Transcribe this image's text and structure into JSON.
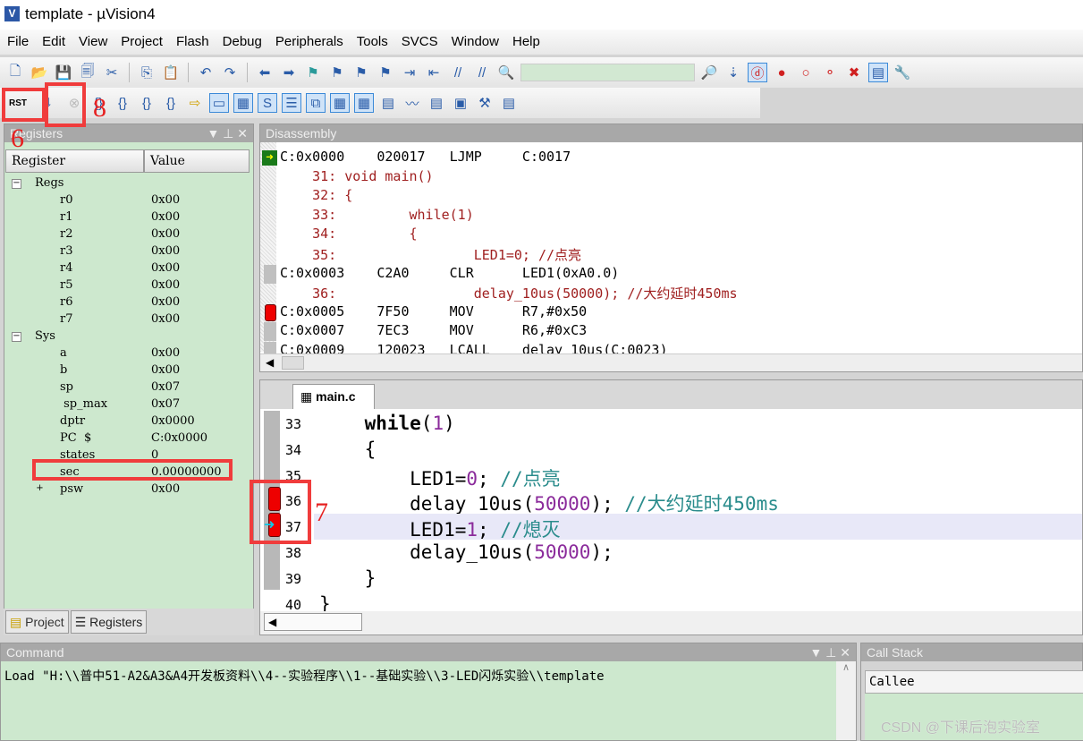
{
  "window": {
    "title": "template  - µVision4",
    "icon": "V"
  },
  "menu": [
    "File",
    "Edit",
    "View",
    "Project",
    "Flash",
    "Debug",
    "Peripherals",
    "Tools",
    "SVCS",
    "Window",
    "Help"
  ],
  "toolbar": {
    "rst_label": "RST",
    "icons1": [
      "new-file",
      "open-folder",
      "save",
      "save-all",
      "cut",
      "copy",
      "paste",
      "undo",
      "redo",
      "nav-back",
      "nav-forward",
      "bookmark",
      "prev-bookmark",
      "next-bookmark",
      "clear-bookmarks",
      "indent",
      "unindent",
      "comment",
      "uncomment",
      "find-in-files"
    ],
    "icons1b": [
      "find",
      "incremental-find",
      "start-debug",
      "insert-breakpoint",
      "enable-breakpoint",
      "disable-breakpoints",
      "kill-breakpoints",
      "window-layout",
      "configure"
    ],
    "icons2": [
      "step-into",
      "step-over",
      "step-out",
      "run-to-cursor",
      "show-next-statement",
      "command-window",
      "disassembly-window",
      "symbols-window",
      "registers-window",
      "call-stack-window",
      "watch-window",
      "memory-window",
      "serial-window",
      "analysis-window",
      "trace-window",
      "system-viewer",
      "toolbox",
      "debug-restore-views"
    ]
  },
  "registers": {
    "title": "Registers",
    "col_register": "Register",
    "col_value": "Value",
    "groups": [
      {
        "name": "Regs",
        "items": [
          [
            "r0",
            "0x00"
          ],
          [
            "r1",
            "0x00"
          ],
          [
            "r2",
            "0x00"
          ],
          [
            "r3",
            "0x00"
          ],
          [
            "r4",
            "0x00"
          ],
          [
            "r5",
            "0x00"
          ],
          [
            "r6",
            "0x00"
          ],
          [
            "r7",
            "0x00"
          ]
        ]
      },
      {
        "name": "Sys",
        "items": [
          [
            "a",
            "0x00"
          ],
          [
            "b",
            "0x00"
          ],
          [
            "sp",
            "0x07"
          ],
          [
            " sp_max",
            "0x07"
          ],
          [
            "dptr",
            "0x0000"
          ],
          [
            "PC  $",
            "C:0x0000"
          ],
          [
            "states",
            "0"
          ],
          [
            "sec",
            "0.00000000"
          ],
          [
            "psw",
            "0x00"
          ]
        ]
      }
    ],
    "tabs": [
      "Project",
      "Registers"
    ]
  },
  "disassembly": {
    "title": "Disassembly",
    "lines": [
      {
        "t": "asm",
        "text": "C:0x0000    020017   LJMP     C:0017",
        "marker": "current"
      },
      {
        "t": "src",
        "text": "    31: void main()"
      },
      {
        "t": "src",
        "text": "    32: {"
      },
      {
        "t": "src",
        "text": "    33:         while(1)"
      },
      {
        "t": "src",
        "text": "    34:         {"
      },
      {
        "t": "src",
        "text": "    35:                 LED1=0; //点亮"
      },
      {
        "t": "asm",
        "text": "C:0x0003    C2A0     CLR      LED1(0xA0.0)",
        "marker": "exec"
      },
      {
        "t": "src",
        "text": "    36:                 delay_10us(50000); //大约延时450ms"
      },
      {
        "t": "asm",
        "text": "C:0x0005    7F50     MOV      R7,#0x50",
        "marker": "breakpoint"
      },
      {
        "t": "asm",
        "text": "C:0x0007    7EC3     MOV      R6,#0xC3",
        "marker": "exec"
      },
      {
        "t": "asm",
        "text": "C:0x0009    120023   LCALL    delay_10us(C:0023)",
        "marker": "exec"
      }
    ]
  },
  "editor": {
    "tab": "main.c",
    "lines": [
      {
        "n": "33",
        "code": [
          [
            "    ",
            ""
          ],
          [
            "while",
            "kw"
          ],
          [
            "(",
            ""
          ],
          [
            "1",
            "num"
          ],
          [
            ")",
            ""
          ]
        ]
      },
      {
        "n": "34",
        "code": [
          [
            "    {",
            ""
          ]
        ]
      },
      {
        "n": "35",
        "code": [
          [
            "        LED1=",
            ""
          ],
          [
            "0",
            "num"
          ],
          [
            "; ",
            ""
          ],
          [
            "//点亮",
            "cm"
          ]
        ]
      },
      {
        "n": "36",
        "code": [
          [
            "        delay_10us(",
            ""
          ],
          [
            "50000",
            "num"
          ],
          [
            "); ",
            ""
          ],
          [
            "//大约延时450ms",
            "cm"
          ]
        ],
        "marker": "breakpoint"
      },
      {
        "n": "37",
        "code": [
          [
            "        LED1=",
            ""
          ],
          [
            "1",
            "num"
          ],
          [
            "; ",
            ""
          ],
          [
            "//熄灭",
            "cm"
          ]
        ],
        "marker": "breakpoint-current"
      },
      {
        "n": "38",
        "code": [
          [
            "        delay_10us(",
            ""
          ],
          [
            "50000",
            "num"
          ],
          [
            ");",
            ""
          ]
        ]
      },
      {
        "n": "39",
        "code": [
          [
            "    }",
            ""
          ]
        ]
      },
      {
        "n": "40",
        "code": [
          [
            "}",
            ""
          ]
        ]
      }
    ]
  },
  "annotations": [
    "6",
    "7",
    "8"
  ],
  "command": {
    "title": "Command",
    "text": "Load \"H:\\\\普中51-A2&A3&A4开发板资料\\\\4--实验程序\\\\1--基础实验\\\\3-LED闪烁实验\\\\template"
  },
  "callstack": {
    "title": "Call Stack",
    "col": "Callee"
  },
  "watermark": "CSDN @下课后泡实验室",
  "panel_buttons": [
    "▼",
    "ᵖ",
    "✕"
  ]
}
